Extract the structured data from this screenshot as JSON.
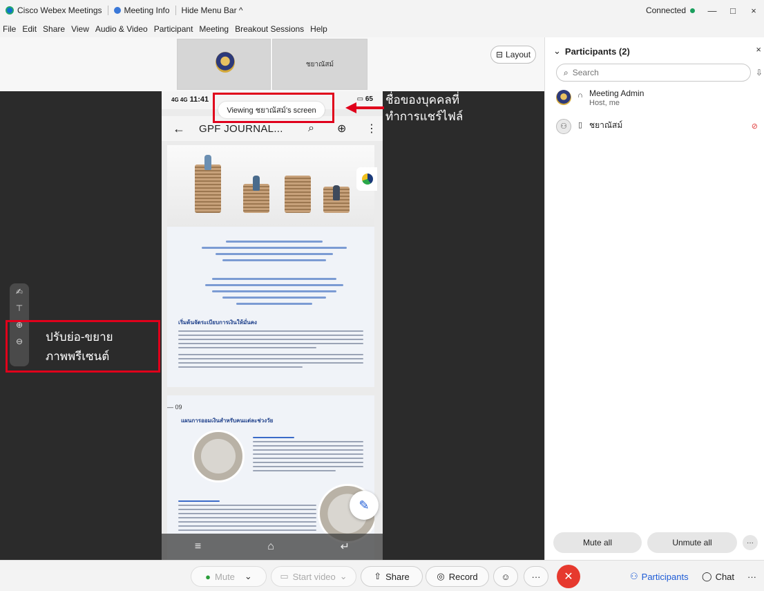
{
  "titlebar": {
    "app_name": "Cisco Webex Meetings",
    "meeting_info": "Meeting Info",
    "hide_menu_bar": "Hide Menu Bar ^",
    "status": "Connected",
    "minimize": "—",
    "maximize": "□",
    "close": "×"
  },
  "menu": [
    "File",
    "Edit",
    "Share",
    "View",
    "Audio & Video",
    "Participant",
    "Meeting",
    "Breakout Sessions",
    "Help"
  ],
  "stage": {
    "thumbnail_name": "ชยาณัสม์",
    "layout_label": "Layout"
  },
  "shared_screen": {
    "viewing_label": "Viewing ชยาณัสม์'s screen",
    "phone_time": "11:41",
    "phone_signal": "4G 4G",
    "phone_battery": "65",
    "app_title": "GPF JOURNAL...",
    "page_number": "09",
    "section_heading_1": "เริ่มต้นจัดระเบียบการเงินให้มั่นคง",
    "section_heading_2": "แผนการออมเงินสำหรับคนแต่ละช่วงวัย"
  },
  "annotations": {
    "sharer_note_line1": "ชื่อของบุคคลที่",
    "sharer_note_line2": "ทำการแชร์ไฟล์",
    "zoom_note_line1": "ปรับย่อ-ขยาย",
    "zoom_note_line2": "ภาพพรีเซนต์"
  },
  "participants_panel": {
    "title": "Participants (2)",
    "search_placeholder": "Search",
    "participants": [
      {
        "name": "Meeting Admin",
        "role": "Host, me"
      },
      {
        "name": "ชยาณัสม์",
        "role": ""
      }
    ],
    "mute_all": "Mute all",
    "unmute_all": "Unmute all"
  },
  "toolbar": {
    "mute": "Mute",
    "start_video": "Start video",
    "share": "Share",
    "record": "Record",
    "participants": "Participants",
    "chat": "Chat",
    "more": "···"
  },
  "colors": {
    "accent": "#1d5bd6",
    "annotation_red": "#e0001b",
    "end_call": "#e6392e",
    "connected": "#1a9f5d"
  }
}
